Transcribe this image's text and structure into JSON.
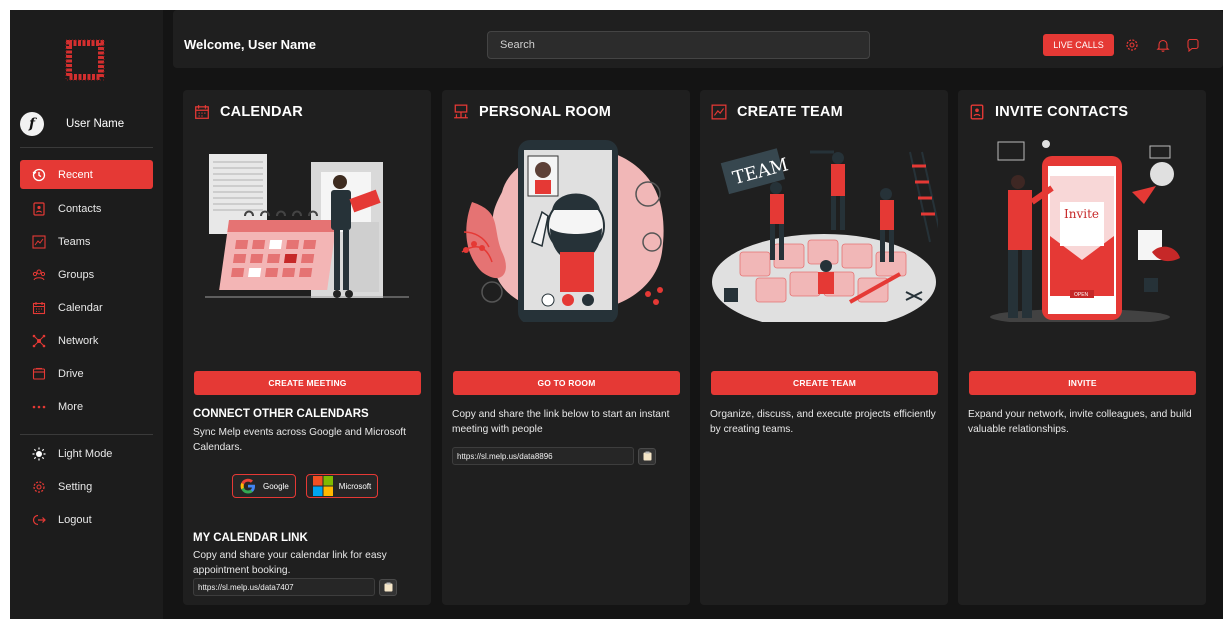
{
  "header": {
    "welcome": "Welcome, User Name",
    "search_placeholder": "Search",
    "live_calls": "LIVE CALLS"
  },
  "sidebar": {
    "user_name": "User Name",
    "items": [
      {
        "label": "Recent",
        "icon": "clock-icon",
        "active": true
      },
      {
        "label": "Contacts",
        "icon": "contacts-icon"
      },
      {
        "label": "Teams",
        "icon": "teams-icon"
      },
      {
        "label": "Groups",
        "icon": "groups-icon"
      },
      {
        "label": "Calendar",
        "icon": "calendar-icon"
      },
      {
        "label": "Network",
        "icon": "network-icon"
      },
      {
        "label": "Drive",
        "icon": "drive-icon"
      },
      {
        "label": "More",
        "icon": "more-dots-icon"
      }
    ],
    "bottom_items": [
      {
        "label": "Light Mode",
        "icon": "sun-icon"
      },
      {
        "label": "Setting",
        "icon": "gear-icon"
      },
      {
        "label": "Logout",
        "icon": "logout-icon"
      }
    ]
  },
  "cards": {
    "calendar": {
      "title": "CALENDAR",
      "button": "CREATE MEETING",
      "connect_title": "CONNECT OTHER CALENDARS",
      "connect_desc": "Sync Melp events across Google and Microsoft Calendars.",
      "google": "Google",
      "microsoft": "Microsoft",
      "link_title": "MY CALENDAR LINK",
      "link_desc": "Copy and share your calendar link for easy appointment booking.",
      "link": "https://sl.melp.us/data7407"
    },
    "personal_room": {
      "title": "PERSONAL ROOM",
      "button": "GO TO ROOM",
      "desc": "Copy and share the link below to start an instant meeting with people",
      "link": "https://sl.melp.us/data8896"
    },
    "create_team": {
      "title": "CREATE TEAM",
      "button": "CREATE TEAM",
      "desc": "Organize, discuss, and execute projects efficiently by creating teams."
    },
    "invite_contacts": {
      "title": "INVITE CONTACTS",
      "button": "INVITE",
      "desc": "Expand your network, invite colleagues, and build valuable relationships.",
      "illus_word": "Invite",
      "illus_open": "OPEN",
      "illus_team": "TEAM"
    }
  },
  "colors": {
    "accent": "#e53935",
    "background": "#141414",
    "panel": "#1f1f1f"
  }
}
